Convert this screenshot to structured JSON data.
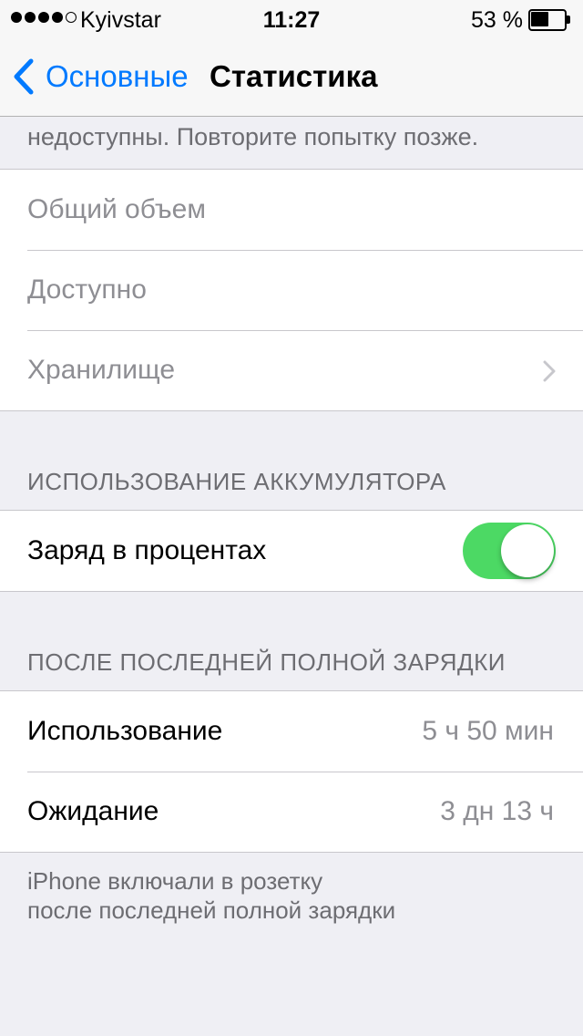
{
  "status_bar": {
    "carrier": "Kyivstar",
    "time": "11:27",
    "battery_percent": "53 %",
    "battery_level": 0.53
  },
  "nav": {
    "back_label": "Основные",
    "title": "Статистика"
  },
  "top_note": "недоступны. Повторите попытку позже.",
  "storage": {
    "total_label": "Общий объем",
    "available_label": "Доступно",
    "storage_label": "Хранилище"
  },
  "battery_section": {
    "header": "ИСПОЛЬЗОВАНИЕ АККУМУЛЯТОРА",
    "percent_label": "Заряд в процентах",
    "percent_enabled": true
  },
  "since_charge": {
    "header": "ПОСЛЕ ПОСЛЕДНЕЙ ПОЛНОЙ ЗАРЯДКИ",
    "usage_label": "Использование",
    "usage_value": "5 ч 50 мин",
    "standby_label": "Ожидание",
    "standby_value": "3 дн 13 ч"
  },
  "footer": {
    "line1": "iPhone включали в розетку",
    "line2": "после последней полной зарядки"
  },
  "colors": {
    "accent": "#007aff",
    "toggle_on": "#4cd964",
    "background": "#efeff4"
  },
  "icons": {
    "back": "chevron-left-icon",
    "disclosure": "chevron-right-icon",
    "battery": "battery-icon",
    "signal": "signal-dots-icon"
  }
}
